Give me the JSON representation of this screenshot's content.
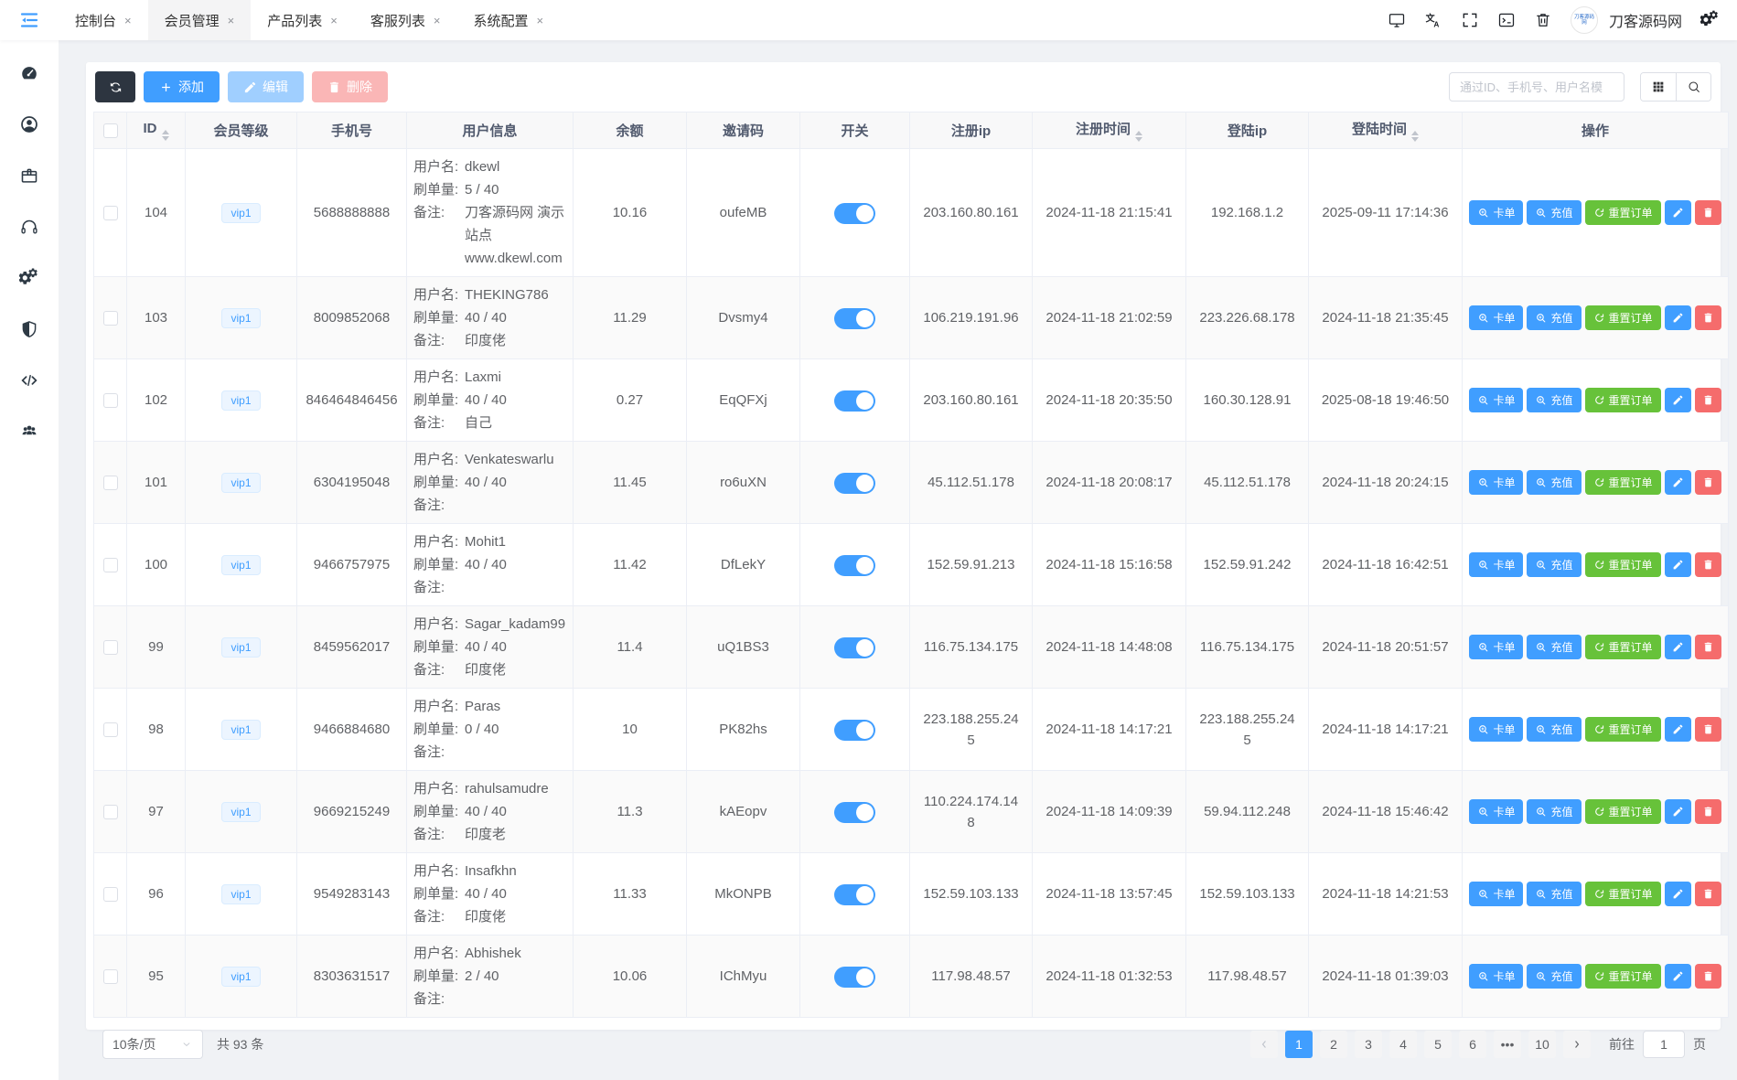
{
  "colors": {
    "primary": "#409eff",
    "success": "#67c23a",
    "danger": "#f56c6c",
    "dark": "#2d3540"
  },
  "topbar": {
    "brand": "刀客源码网",
    "icons": [
      {
        "name": "monitor"
      },
      {
        "name": "translate"
      },
      {
        "name": "fullscreen"
      },
      {
        "name": "terminal"
      },
      {
        "name": "trash"
      }
    ],
    "settings_icon": "settings"
  },
  "tabs": {
    "close_glyph": "×",
    "items": [
      {
        "name": "console",
        "label": "控制台",
        "active": false
      },
      {
        "name": "members",
        "label": "会员管理",
        "active": true
      },
      {
        "name": "products",
        "label": "产品列表",
        "active": false
      },
      {
        "name": "support",
        "label": "客服列表",
        "active": false
      },
      {
        "name": "system",
        "label": "系统配置",
        "active": false
      }
    ]
  },
  "sidebar": {
    "items": [
      {
        "name": "dashboard",
        "icon": "dashboard"
      },
      {
        "name": "members",
        "icon": "user-circle"
      },
      {
        "name": "products",
        "icon": "package"
      },
      {
        "name": "support",
        "icon": "headset"
      },
      {
        "name": "services",
        "icon": "gears"
      },
      {
        "name": "security",
        "icon": "shield"
      },
      {
        "name": "code",
        "icon": "code"
      },
      {
        "name": "users",
        "icon": "users"
      }
    ]
  },
  "toolbar": {
    "add_label": "添加",
    "edit_label": "编辑",
    "delete_label": "删除"
  },
  "search": {
    "placeholder": "通过ID、手机号、用户名模"
  },
  "table": {
    "userinfo_labels": {
      "username": "用户名:",
      "orders": "刷单量:",
      "remark": "备注:"
    },
    "headers": [
      {
        "name": "id",
        "label": "ID",
        "sortable": true
      },
      {
        "name": "level",
        "label": "会员等级"
      },
      {
        "name": "phone",
        "label": "手机号"
      },
      {
        "name": "userinfo",
        "label": "用户信息"
      },
      {
        "name": "balance",
        "label": "余额"
      },
      {
        "name": "invite",
        "label": "邀请码"
      },
      {
        "name": "switch",
        "label": "开关"
      },
      {
        "name": "reg-ip",
        "label": "注册ip"
      },
      {
        "name": "reg-time",
        "label": "注册时间",
        "sortable": true
      },
      {
        "name": "login-ip",
        "label": "登陆ip"
      },
      {
        "name": "login-time",
        "label": "登陆时间",
        "sortable": true
      },
      {
        "name": "actions",
        "label": "操作"
      }
    ],
    "action_buttons": [
      {
        "name": "view-card-button",
        "label": "卡单",
        "icon": "zoom",
        "type": "blue"
      },
      {
        "name": "recharge-button",
        "label": "充值",
        "icon": "zoom",
        "type": "blue"
      },
      {
        "name": "reset-orders-button",
        "label": "重置订单",
        "icon": "redo",
        "type": "green"
      },
      {
        "name": "edit-row-button",
        "label": "",
        "icon": "pencil",
        "type": "blue",
        "square": true
      },
      {
        "name": "delete-row-button",
        "label": "",
        "icon": "trash2",
        "type": "red",
        "square": true
      }
    ],
    "rows": [
      {
        "id": "104",
        "level": "vip1",
        "phone": "5688888888",
        "username": "dkewl",
        "orders": "5 / 40",
        "remark": "刀客源码网 演示站点 www.dkewl.com",
        "balance": "10.16",
        "invite": "oufeMB",
        "switch_on": true,
        "reg_ip": "203.160.80.161",
        "reg_time": "2024-11-18 21:15:41",
        "login_ip": "192.168.1.2",
        "login_time": "2025-09-11 17:14:36"
      },
      {
        "id": "103",
        "level": "vip1",
        "phone": "8009852068",
        "username": "THEKING786",
        "orders": "40 / 40",
        "remark": "印度佬",
        "balance": "11.29",
        "invite": "Dvsmy4",
        "switch_on": true,
        "reg_ip": "106.219.191.96",
        "reg_time": "2024-11-18 21:02:59",
        "login_ip": "223.226.68.178",
        "login_time": "2024-11-18 21:35:45"
      },
      {
        "id": "102",
        "level": "vip1",
        "phone": "846464846456",
        "username": "Laxmi",
        "orders": "40 / 40",
        "remark": "自己",
        "balance": "0.27",
        "invite": "EqQFXj",
        "switch_on": true,
        "reg_ip": "203.160.80.161",
        "reg_time": "2024-11-18 20:35:50",
        "login_ip": "160.30.128.91",
        "login_time": "2025-08-18 19:46:50"
      },
      {
        "id": "101",
        "level": "vip1",
        "phone": "6304195048",
        "username": "Venkateswarlu",
        "orders": "40 / 40",
        "remark": "",
        "balance": "11.45",
        "invite": "ro6uXN",
        "switch_on": true,
        "reg_ip": "45.112.51.178",
        "reg_time": "2024-11-18 20:08:17",
        "login_ip": "45.112.51.178",
        "login_time": "2024-11-18 20:24:15"
      },
      {
        "id": "100",
        "level": "vip1",
        "phone": "9466757975",
        "username": "Mohit1",
        "orders": "40 / 40",
        "remark": "",
        "balance": "11.42",
        "invite": "DfLekY",
        "switch_on": true,
        "reg_ip": "152.59.91.213",
        "reg_time": "2024-11-18 15:16:58",
        "login_ip": "152.59.91.242",
        "login_time": "2024-11-18 16:42:51"
      },
      {
        "id": "99",
        "level": "vip1",
        "phone": "8459562017",
        "username": "Sagar_kadam99",
        "orders": "40 / 40",
        "remark": "印度佬",
        "balance": "11.4",
        "invite": "uQ1BS3",
        "switch_on": true,
        "reg_ip": "116.75.134.175",
        "reg_time": "2024-11-18 14:48:08",
        "login_ip": "116.75.134.175",
        "login_time": "2024-11-18 20:51:57"
      },
      {
        "id": "98",
        "level": "vip1",
        "phone": "9466884680",
        "username": "Paras",
        "orders": "0 / 40",
        "remark": "",
        "balance": "10",
        "invite": "PK82hs",
        "switch_on": true,
        "reg_ip": "223.188.255.245",
        "reg_time": "2024-11-18 14:17:21",
        "login_ip": "223.188.255.245",
        "login_time": "2024-11-18 14:17:21"
      },
      {
        "id": "97",
        "level": "vip1",
        "phone": "9669215249",
        "username": "rahulsamudre",
        "orders": "40 / 40",
        "remark": "印度老",
        "balance": "11.3",
        "invite": "kAEopv",
        "switch_on": true,
        "reg_ip": "110.224.174.148",
        "reg_time": "2024-11-18 14:09:39",
        "login_ip": "59.94.112.248",
        "login_time": "2024-11-18 15:46:42"
      },
      {
        "id": "96",
        "level": "vip1",
        "phone": "9549283143",
        "username": "Insafkhn",
        "orders": "40 / 40",
        "remark": "印度佬",
        "balance": "11.33",
        "invite": "MkONPB",
        "switch_on": true,
        "reg_ip": "152.59.103.133",
        "reg_time": "2024-11-18 13:57:45",
        "login_ip": "152.59.103.133",
        "login_time": "2024-11-18 14:21:53"
      },
      {
        "id": "95",
        "level": "vip1",
        "phone": "8303631517",
        "username": "Abhishek",
        "orders": "2 / 40",
        "remark": "",
        "balance": "10.06",
        "invite": "IChMyu",
        "switch_on": true,
        "reg_ip": "117.98.48.57",
        "reg_time": "2024-11-18 01:32:53",
        "login_ip": "117.98.48.57",
        "login_time": "2024-11-18 01:39:03"
      }
    ]
  },
  "pagination": {
    "page_size": "10条/页",
    "total": "共 93 条",
    "pages": [
      {
        "label": "1",
        "active": true
      },
      {
        "label": "2"
      },
      {
        "label": "3"
      },
      {
        "label": "4"
      },
      {
        "label": "5"
      },
      {
        "label": "6"
      },
      {
        "label": "•••",
        "more": true
      },
      {
        "label": "10"
      }
    ],
    "goto_label": "前往",
    "goto_value": "1",
    "goto_suffix": "页"
  }
}
